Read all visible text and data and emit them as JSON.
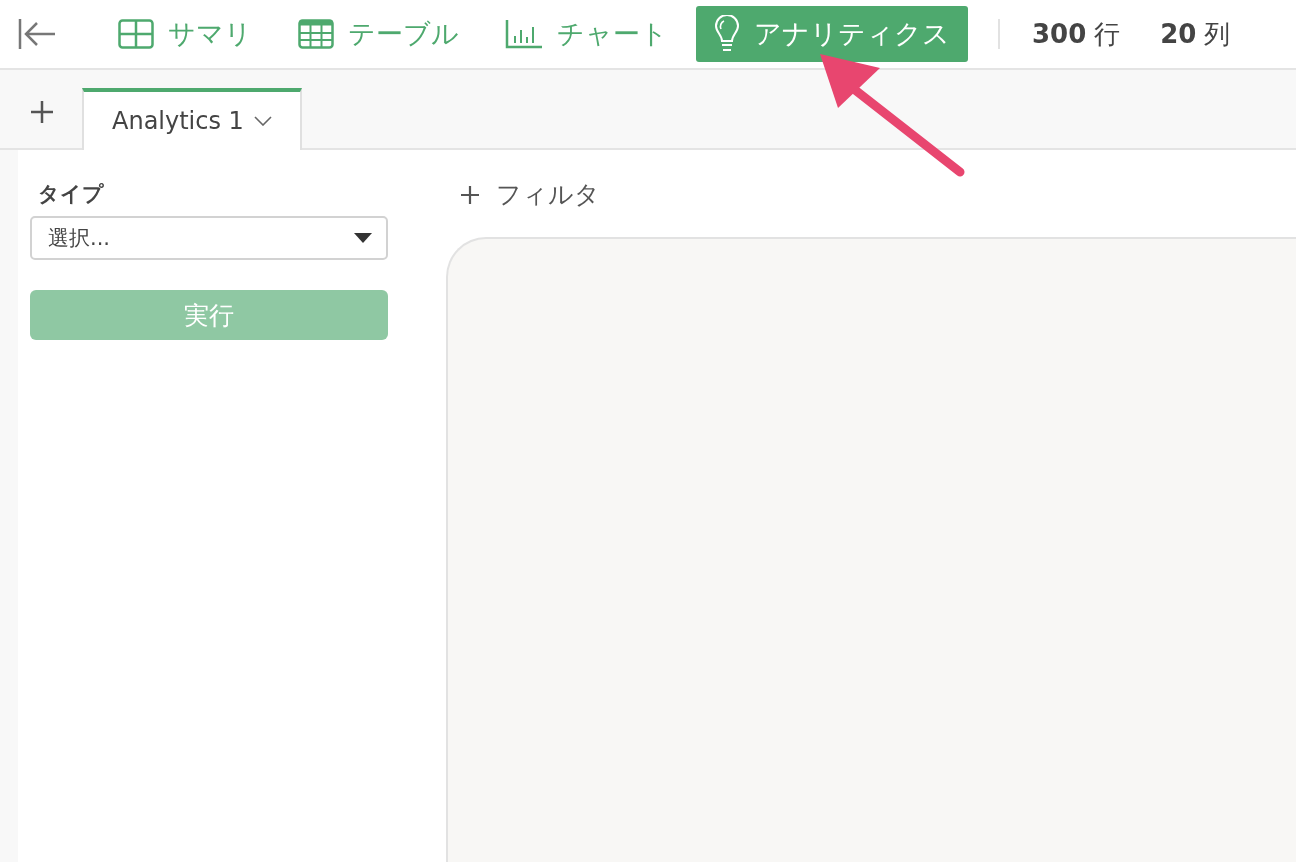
{
  "toolbar": {
    "views": [
      {
        "label": "サマリ",
        "kind": "summary",
        "selected": false
      },
      {
        "label": "テーブル",
        "kind": "table",
        "selected": false
      },
      {
        "label": "チャート",
        "kind": "chart",
        "selected": false
      },
      {
        "label": "アナリティクス",
        "kind": "analytics",
        "selected": true
      }
    ],
    "row_count": "300",
    "row_unit": "行",
    "column_count": "20",
    "column_unit": "列"
  },
  "tabs": [
    {
      "label": "Analytics 1",
      "selected": true
    }
  ],
  "panel": {
    "type_label": "タイプ",
    "type_select": {
      "value": "選択..."
    },
    "run_button": {
      "label": "実行",
      "disabled": true
    }
  },
  "filter": {
    "label": "フィルタ"
  }
}
